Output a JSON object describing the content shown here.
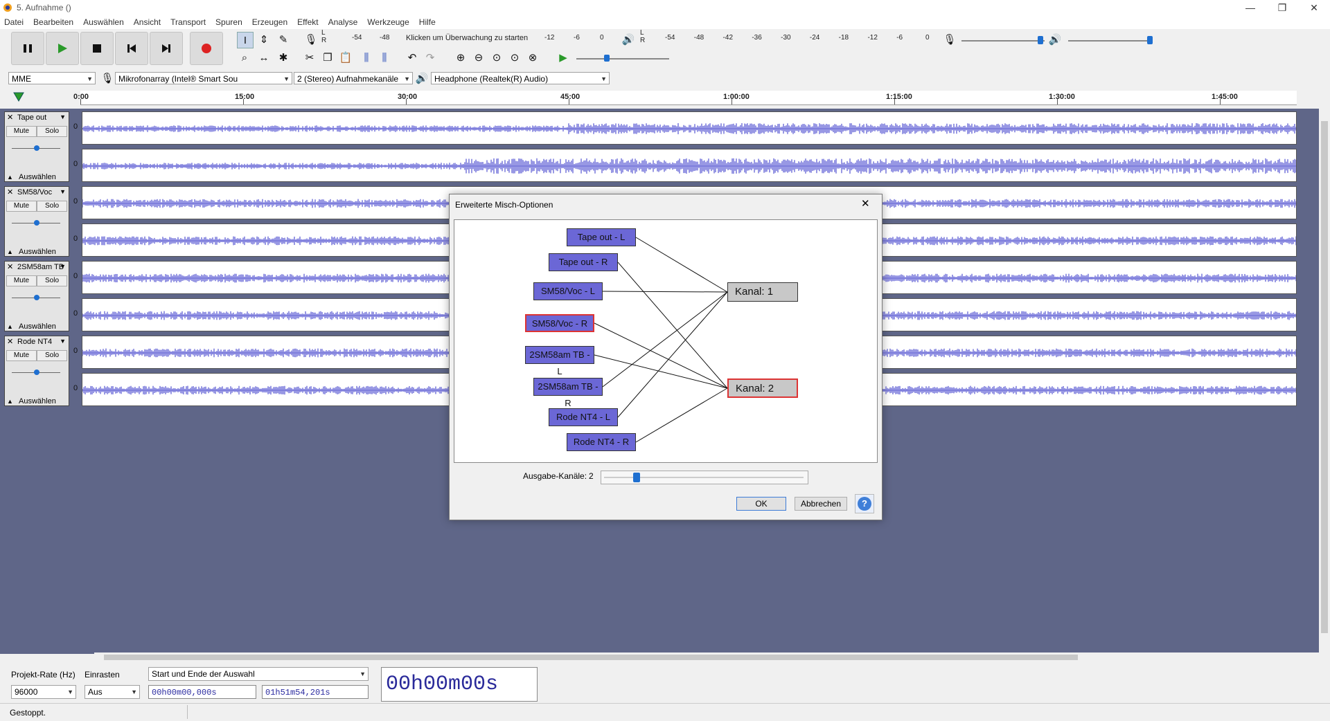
{
  "window": {
    "title": "5. Aufnahme ()",
    "minimize": "—",
    "restore": "❐",
    "close": "✕"
  },
  "menu": [
    "Datei",
    "Bearbeiten",
    "Auswählen",
    "Ansicht",
    "Transport",
    "Spuren",
    "Erzeugen",
    "Effekt",
    "Analyse",
    "Werkzeuge",
    "Hilfe"
  ],
  "meters": {
    "record_ticks": [
      "-54",
      "-48",
      "-12",
      "-6",
      "0"
    ],
    "record_hint": "Klicken um Überwachung zu starten",
    "play_ticks": [
      "-54",
      "-48",
      "-42",
      "-36",
      "-30",
      "-24",
      "-18",
      "-12",
      "-6",
      "0"
    ],
    "l_label": "L",
    "r_label": "R"
  },
  "devices": {
    "host": "MME",
    "recording_device": "Mikrofonarray (Intel® Smart Sou",
    "recording_channels": "2 (Stereo) Aufnahmekanäle",
    "playback_device": "Headphone (Realtek(R) Audio)"
  },
  "timeline": {
    "ticks": [
      "0:00",
      "15:00",
      "30:00",
      "45:00",
      "1:00:00",
      "1:15:00",
      "1:30:00",
      "1:45:00"
    ]
  },
  "tracks": [
    {
      "name": "Tape out",
      "mute": "Mute",
      "solo": "Solo",
      "select": "Auswählen",
      "zero": "0"
    },
    {
      "name": "SM58/Voc",
      "mute": "Mute",
      "solo": "Solo",
      "select": "Auswählen",
      "zero": "0"
    },
    {
      "name": "2SM58am TB",
      "mute": "Mute",
      "solo": "Solo",
      "select": "Auswählen",
      "zero": "0"
    },
    {
      "name": "Rode NT4",
      "mute": "Mute",
      "solo": "Solo",
      "select": "Auswählen",
      "zero": "0"
    }
  ],
  "dialog": {
    "title": "Erweiterte Misch-Optionen",
    "sources": [
      "Tape out - L",
      "Tape out - R",
      "SM58/Voc - L",
      "SM58/Voc - R",
      "2SM58am TB - L",
      "2SM58am TB - R",
      "Rode NT4 - L",
      "Rode NT4 - R"
    ],
    "selected_source": "SM58/Voc - R",
    "outputs": [
      "Kanal:  1",
      "Kanal:  2"
    ],
    "selected_output": "Kanal:  2",
    "output_label": "Ausgabe-Kanäle:",
    "output_count": "2",
    "ok": "OK",
    "cancel": "Abbrechen",
    "help": "?"
  },
  "selection_toolbar": {
    "rate_label": "Projekt-Rate (Hz)",
    "rate_value": "96000",
    "snap_label": "Einrasten",
    "snap_value": "Aus",
    "mode": "Start und Ende der Auswahl",
    "start": "00h00m00,000s",
    "end": "01h51m54,201s",
    "audio_position": "00h00m00s"
  },
  "status": "Gestoppt.",
  "colors": {
    "waveform": "#3232c8",
    "track_bg": "#5f6688",
    "source_box": "#6b67d6",
    "selected_border": "#dd3333",
    "record": "#dd2222",
    "play": "#2a9a2a"
  }
}
